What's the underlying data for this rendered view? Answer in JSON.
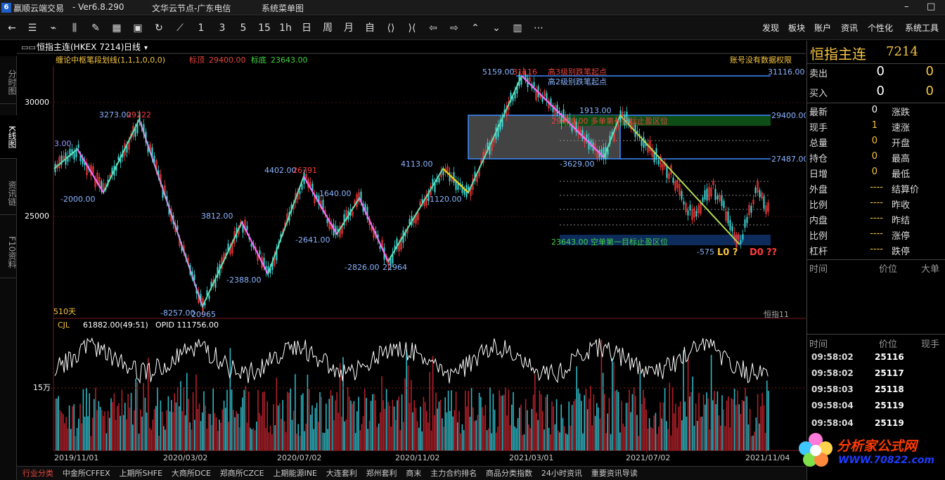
{
  "titlebar": {
    "app_icon": "6",
    "app_name": "赢顺云端交易",
    "version": "-  Ver6.8.290",
    "node": "文华云节点-广东电信",
    "menu": "系统菜单图"
  },
  "toolbar": {
    "periods": [
      "1",
      "3",
      "5",
      "15",
      "1h",
      "日",
      "周",
      "月",
      "自"
    ],
    "menus": [
      "发现",
      "板块",
      "账户",
      "资讯",
      "个性化",
      "系统工具"
    ]
  },
  "chart_header": {
    "symbol": "恒指主连(HKEX 7214)",
    "period": "日线"
  },
  "left_tabs": [
    "分时图",
    "K线图",
    "资讯链",
    "F10资料"
  ],
  "indicator": {
    "name": "缠论中枢笔段划线(1,1,1,0,0,0)",
    "top_label": "标顶",
    "top_value": "29400.00",
    "bottom_label": "标底",
    "bottom_value": "23643.00",
    "no_permission": "账号没有数据权限"
  },
  "annotations": {
    "high_start_3": "高3级别跌笔起点",
    "high_start_2": "高2级别跌笔起点",
    "long_target": "29400.00  多单第一目标止盈区位",
    "short_target": "23643.00  空单第一目标止盈区位",
    "days": "510天",
    "footer_tag": "恒指11",
    "signal": "L0 ?",
    "d0": "D0",
    "qq": "??",
    "right_prices": [
      "31116.00",
      "29400.00",
      "27487.00"
    ]
  },
  "volume": {
    "label": "CJL",
    "value": "61882.00(49:51)",
    "opid": "OPID 111756.00",
    "axis_15w": "15万"
  },
  "chart_data": {
    "type": "candlestick",
    "y_ticks": [
      30000,
      25000
    ],
    "x_ticks": [
      "2019/11/01",
      "2020/03/02",
      "2020/07/02",
      "2020/11/02",
      "2021/03/01",
      "2021/07/02",
      "2021/11/04"
    ],
    "ylim": [
      20500,
      31600
    ],
    "pivot_labels": [
      {
        "text": "3.00",
        "value": 27800
      },
      {
        "text": "-2000.00",
        "value": 26400
      },
      {
        "text": "3273.00",
        "value": 29500
      },
      {
        "text": "29222",
        "value": 29300
      },
      {
        "text": "-8257.00",
        "value": 21300
      },
      {
        "text": "20965",
        "value": 21100
      },
      {
        "text": "3812.00",
        "value": 25200
      },
      {
        "text": "-2388.00",
        "value": 22900
      },
      {
        "text": "4402.00",
        "value": 27600
      },
      {
        "text": "26791",
        "value": 27400
      },
      {
        "text": "-2641.00",
        "value": 24500
      },
      {
        "text": "1640.00",
        "value": 26700
      },
      {
        "text": "-2826.00",
        "value": 23300
      },
      {
        "text": "22964",
        "value": 23100
      },
      {
        "text": "4113.00",
        "value": 27900
      },
      {
        "text": "-1120.00",
        "value": 26500
      },
      {
        "text": "5159.00",
        "value": 31700
      },
      {
        "text": "31116",
        "value": 31500
      },
      {
        "text": "1913.00",
        "value": 29600
      },
      {
        "text": "-3629.00",
        "value": 27700
      },
      {
        "text": "-575",
        "value": 23000
      }
    ]
  }
}
